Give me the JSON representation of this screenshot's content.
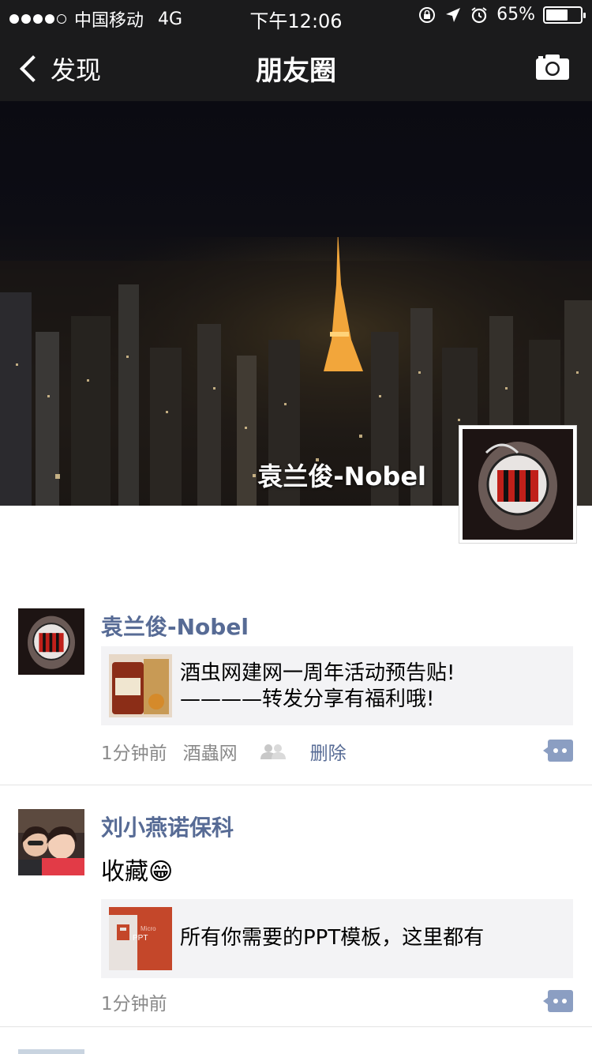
{
  "status_bar": {
    "carrier": "中国移动",
    "network": "4G",
    "time": "下午12:06",
    "battery_percent": "65%",
    "battery_level": 0.65
  },
  "nav": {
    "back_label": "发现",
    "title": "朋友圈",
    "right_icon": "camera-icon"
  },
  "cover": {
    "user_name": "袁兰俊-Nobel"
  },
  "posts": [
    {
      "name": "袁兰俊-Nobel",
      "link_title_line1": "酒虫网建网一周年活动预告贴!",
      "link_title_line2": "————转发分享有福利哦!",
      "time": "1分钟前",
      "source": "酒蟲网",
      "delete_label": "删除"
    },
    {
      "name": "刘小燕诺保科",
      "text": "收藏😁",
      "link_title": "所有你需要的PPT模板，这里都有",
      "time": "1分钟前"
    }
  ],
  "colors": {
    "bar_bg": "#1b1b1c",
    "link_blue": "#576b95",
    "card_bg": "#f3f3f5"
  }
}
